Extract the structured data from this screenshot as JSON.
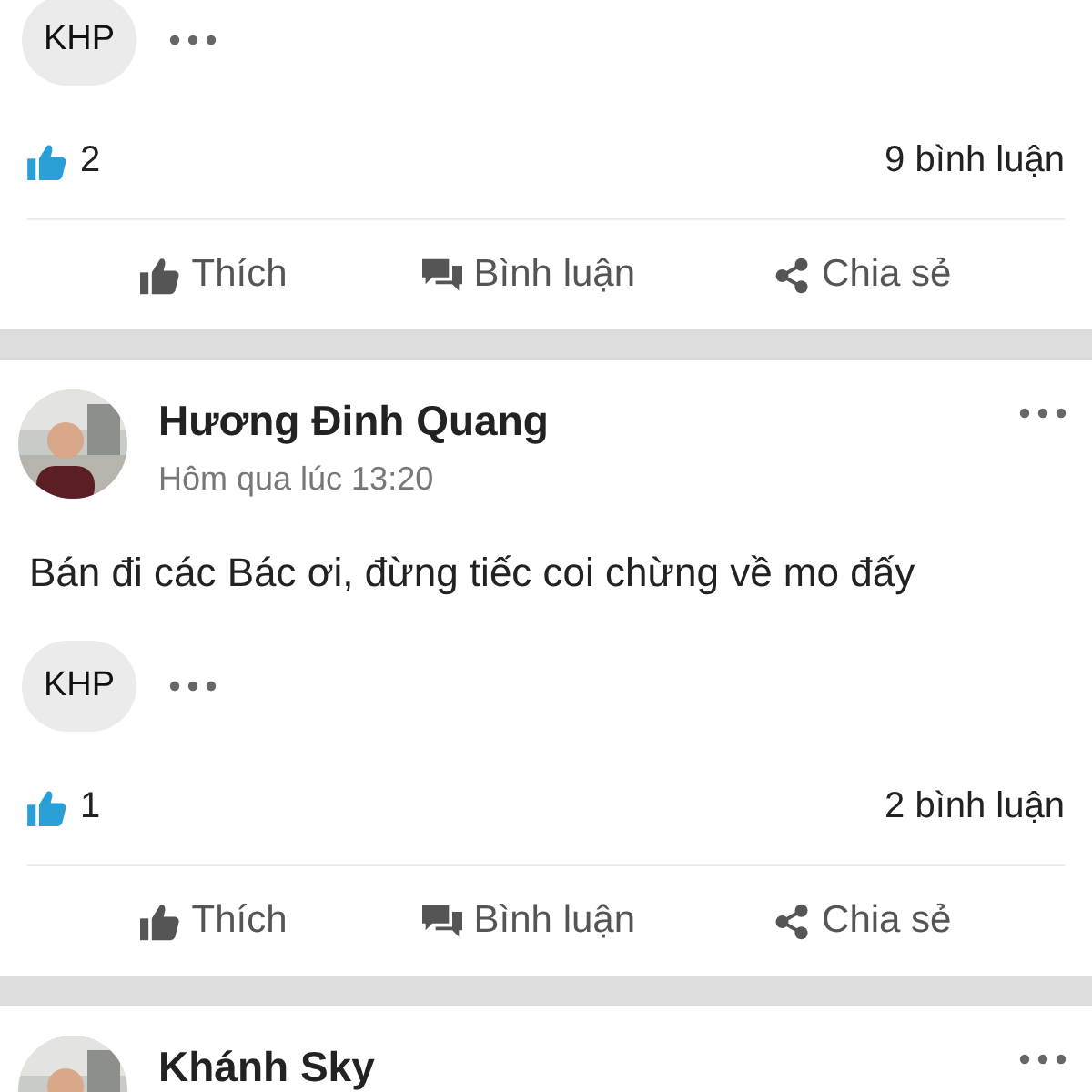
{
  "posts": [
    {
      "tags": [
        "KHP"
      ],
      "likes": "2",
      "comments": "9 bình luận",
      "actions": [
        "Thích",
        "Bình luận",
        "Chia sẻ"
      ]
    },
    {
      "author": "Hương Đinh Quang",
      "time": "Hôm qua lúc 13:20",
      "text": "Bán đi các Bác ơi, đừng tiếc coi chừng về mo đấy",
      "tags": [
        "KHP"
      ],
      "likes": "1",
      "comments": "2 bình luận",
      "actions": [
        "Thích",
        "Bình luận",
        "Chia sẻ"
      ]
    },
    {
      "author": "Khánh Sky"
    }
  ]
}
